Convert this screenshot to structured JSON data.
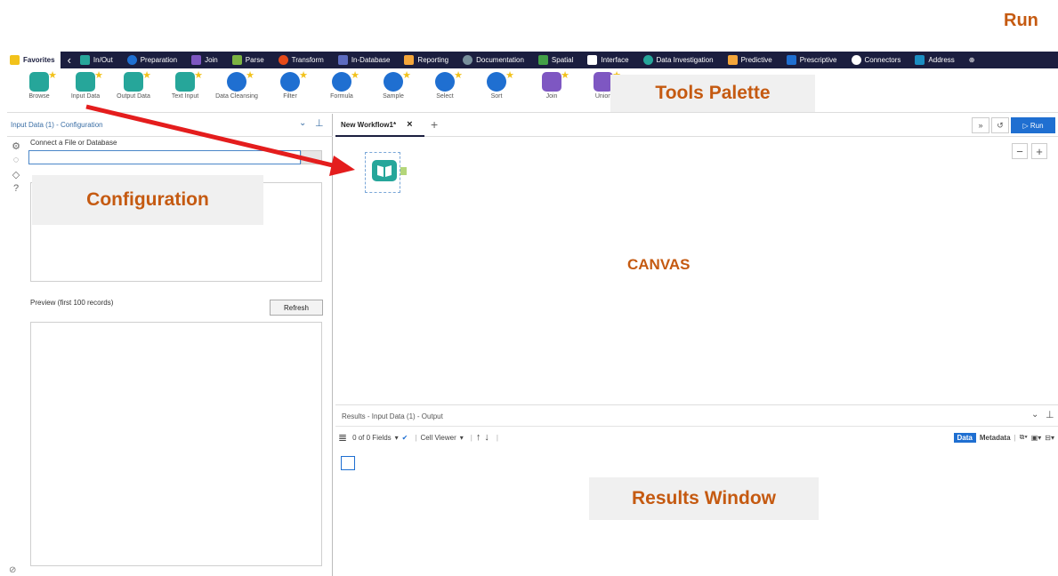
{
  "annotations": {
    "run": "Run",
    "tools_palette": "Tools Palette",
    "configuration": "Configuration",
    "canvas": "CANVAS",
    "results_window": "Results Window"
  },
  "categories": [
    {
      "label": "Favorites",
      "color": "#f2c21b"
    },
    {
      "label": "In/Out",
      "color": "#26a69a"
    },
    {
      "label": "Preparation",
      "color": "#1f6fd1"
    },
    {
      "label": "Join",
      "color": "#7e57c2"
    },
    {
      "label": "Parse",
      "color": "#7cb342"
    },
    {
      "label": "Transform",
      "color": "#e64a19"
    },
    {
      "label": "In-Database",
      "color": "#5c6bc0"
    },
    {
      "label": "Reporting",
      "color": "#f4a63a"
    },
    {
      "label": "Documentation",
      "color": "#78909c"
    },
    {
      "label": "Spatial",
      "color": "#43a047"
    },
    {
      "label": "Interface",
      "color": "#ffffff"
    },
    {
      "label": "Data Investigation",
      "color": "#26a69a"
    },
    {
      "label": "Predictive",
      "color": "#f4a63a"
    },
    {
      "label": "Prescriptive",
      "color": "#1f6fd1"
    },
    {
      "label": "Connectors",
      "color": "#ffffff"
    },
    {
      "label": "Address",
      "color": "#1b8ec2"
    }
  ],
  "tools": [
    {
      "label": "Browse",
      "color": "#26a69a"
    },
    {
      "label": "Input Data",
      "color": "#26a69a"
    },
    {
      "label": "Output Data",
      "color": "#26a69a"
    },
    {
      "label": "Text Input",
      "color": "#26a69a"
    },
    {
      "label": "Data Cleansing",
      "color": "#1f6fd1"
    },
    {
      "label": "Filter",
      "color": "#1f6fd1"
    },
    {
      "label": "Formula",
      "color": "#1f6fd1"
    },
    {
      "label": "Sample",
      "color": "#1f6fd1"
    },
    {
      "label": "Select",
      "color": "#1f6fd1"
    },
    {
      "label": "Sort",
      "color": "#1f6fd1"
    },
    {
      "label": "Join",
      "color": "#7e57c2"
    },
    {
      "label": "Union",
      "color": "#7e57c2"
    }
  ],
  "config": {
    "header": "Input Data (1) - Configuration",
    "connect_label": "Connect a File or Database",
    "preview_label": "Preview (first 100 records)",
    "refresh": "Refresh"
  },
  "workflow": {
    "tab_label": "New Workflow1*",
    "close": "×",
    "add": "+",
    "run_label": "▷ Run",
    "zoom_out": "−",
    "zoom_in": "+"
  },
  "results": {
    "header": "Results - Input Data (1) - Output",
    "fields": "0 of 0 Fields",
    "cell_viewer": "Cell Viewer",
    "data": "Data",
    "metadata": "Metadata"
  }
}
